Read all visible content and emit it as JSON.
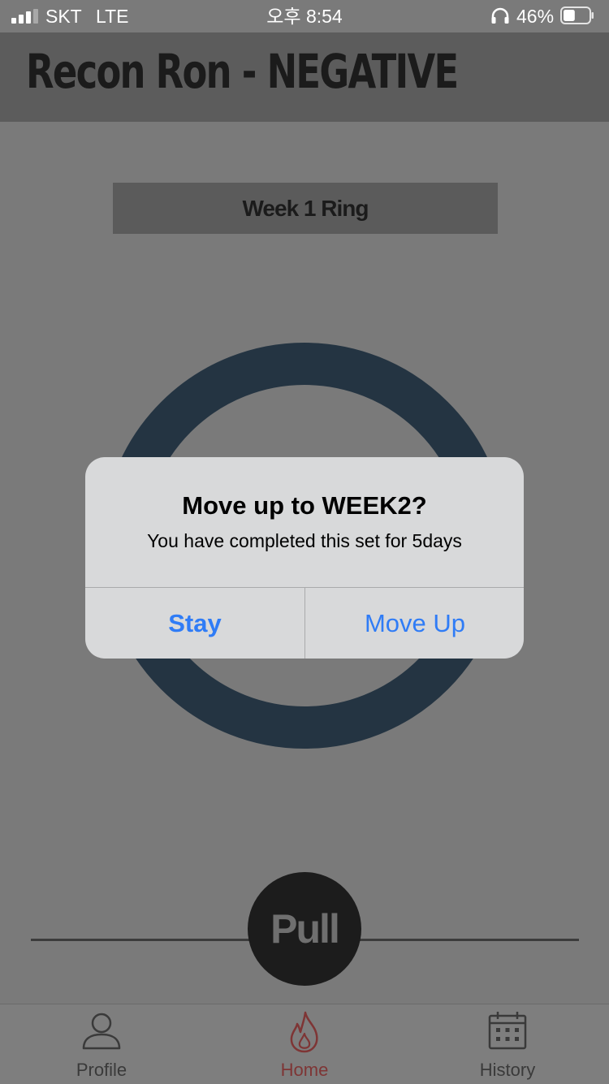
{
  "status_bar": {
    "carrier": "SKT",
    "network": "LTE",
    "time": "오후 8:54",
    "battery_percent": "46%",
    "battery_level": 0.46,
    "signal_bars": 3,
    "signal_bars_total": 4
  },
  "header": {
    "title": "Recon Ron - NEGATIVE"
  },
  "week_label": "Week 1 Ring",
  "ring": {
    "color": "#243442"
  },
  "pull_button": {
    "label": "Pull"
  },
  "dialog": {
    "title": "Move up to WEEK2?",
    "message": "You have completed this set for 5days",
    "stay_label": "Stay",
    "move_up_label": "Move Up",
    "button_color": "#2f7cf6"
  },
  "tab_bar": {
    "tabs": [
      {
        "label": "Profile",
        "icon": "person-icon"
      },
      {
        "label": "Home",
        "icon": "flame-icon",
        "active": true
      },
      {
        "label": "History",
        "icon": "calendar-icon"
      }
    ],
    "active_color": "#7e3535"
  }
}
